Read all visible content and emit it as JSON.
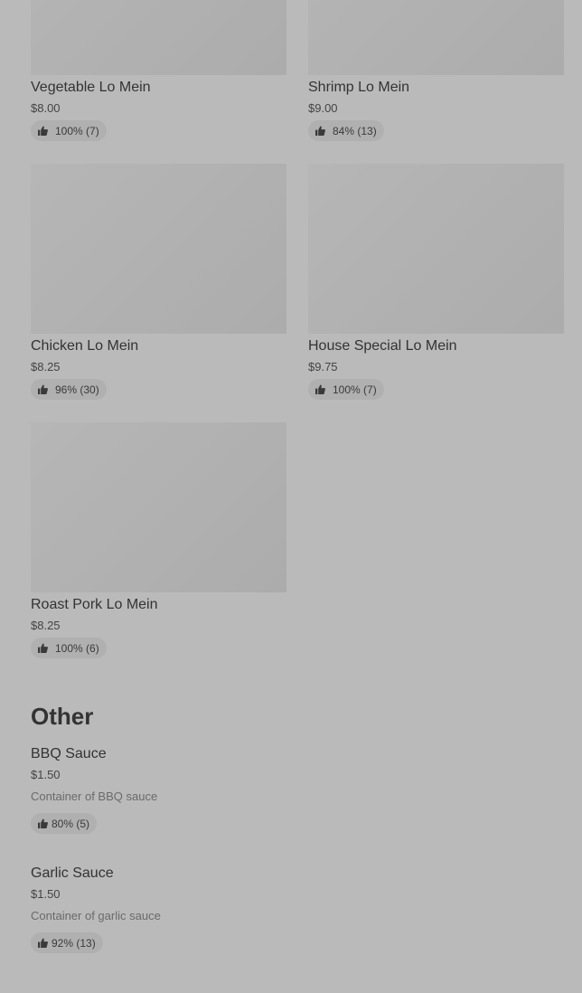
{
  "menu_items": [
    {
      "name": "Vegetable Lo Mein",
      "price": "$8.00",
      "rating": "100% (7)",
      "icon": "thumbs-up-icon"
    },
    {
      "name": "Shrimp Lo Mein",
      "price": "$9.00",
      "rating": "84% (13)",
      "icon": "thumbs-up-icon"
    },
    {
      "name": "Chicken Lo Mein",
      "price": "$8.25",
      "rating": "96% (30)",
      "icon": "thumbs-up-icon"
    },
    {
      "name": "House Special Lo Mein",
      "price": "$9.75",
      "rating": "100% (7)",
      "icon": "thumbs-up-icon"
    },
    {
      "name": "Roast Pork Lo Mein",
      "price": "$8.25",
      "rating": "100% (6)",
      "icon": "thumbs-up-icon"
    }
  ],
  "other_section": {
    "title": "Other",
    "items": [
      {
        "name": "BBQ Sauce",
        "price": "$1.50",
        "description": "Container of BBQ sauce",
        "rating": "80% (5)"
      },
      {
        "name": "Garlic Sauce",
        "price": "$1.50",
        "description": "Container of garlic sauce",
        "rating": "92% (13)"
      }
    ]
  },
  "colors": {
    "overlay_background": "#bababa",
    "image_placeholder": "#b2b2b2",
    "badge_background": "#b0b0b0",
    "text_primary": "#333333",
    "text_secondary": "#6a6a6a"
  }
}
